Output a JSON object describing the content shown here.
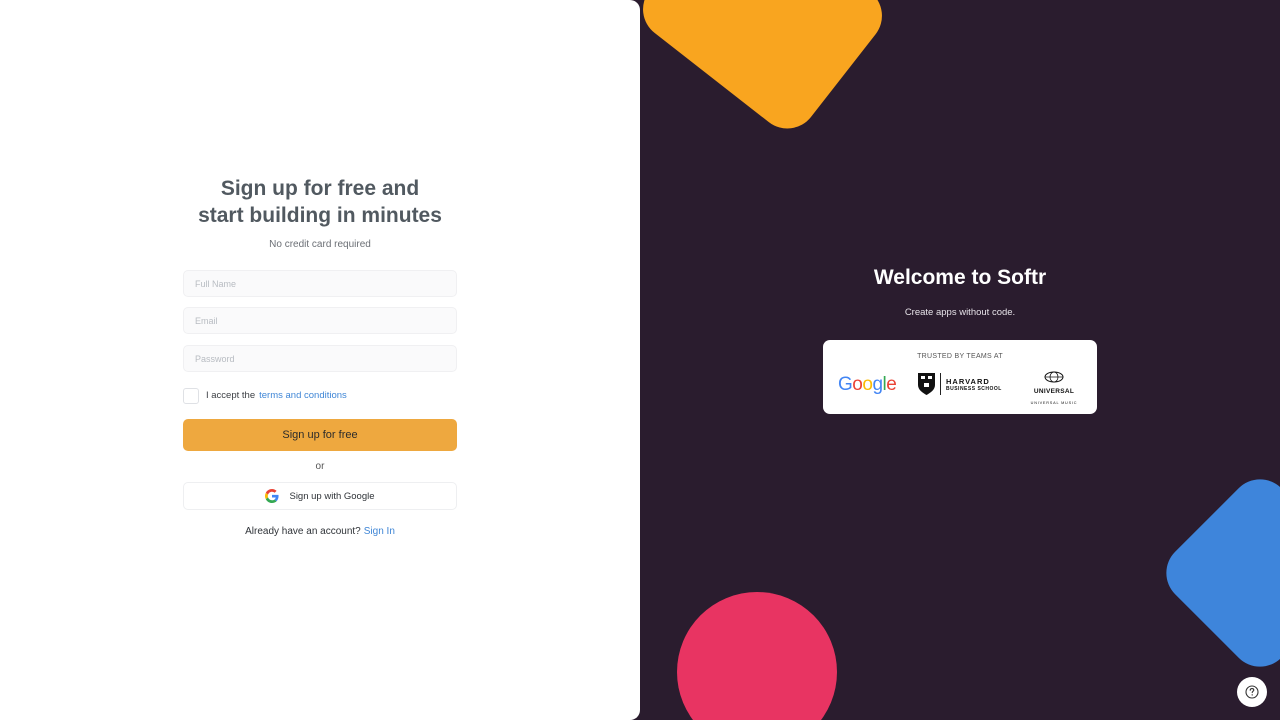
{
  "signup": {
    "title_line1": "Sign up for free and",
    "title_line2": "start building in minutes",
    "subtitle": "No credit card required",
    "fields": {
      "full_name_placeholder": "Full Name",
      "email_placeholder": "Email",
      "password_placeholder": "Password"
    },
    "accept_text": "I accept the",
    "terms_link": "terms and conditions",
    "submit_label": "Sign up for free",
    "or_text": "or",
    "google_label": "Sign up with Google",
    "already_text": "Already have an account?",
    "signin_link": "Sign In"
  },
  "welcome": {
    "title": "Welcome to Softr",
    "tagline": "Create apps without code.",
    "trusted_label": "TRUSTED BY TEAMS AT",
    "logos": {
      "google": "Google",
      "hbs_line1": "HARVARD",
      "hbs_line2": "BUSINESS SCHOOL",
      "um_line1": "UNIVERSAL",
      "um_line2": "UNIVERSAL MUSIC"
    }
  },
  "icons": {
    "google": "google-g-icon",
    "help": "question-circle-icon"
  },
  "colors": {
    "right_bg": "#2a1c2e",
    "primary_button": "#eea83f",
    "link": "#3f86d6",
    "shape_orange": "#f9a51f",
    "shape_pink": "#e83462",
    "shape_blue": "#3e85db"
  }
}
